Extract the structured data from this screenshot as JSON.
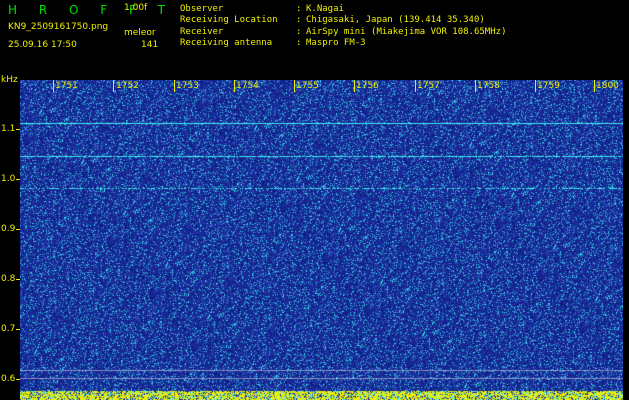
{
  "header": {
    "brand": "H R O F F T",
    "version": "1.00f",
    "filename": "KN9_2509161750.png",
    "detector": "meleor",
    "datetime": "25.09.16 17:50",
    "count": "141"
  },
  "meta": [
    {
      "label": "Observer",
      "value": "K.Nagai"
    },
    {
      "label": "Receiving Location",
      "value": "Chigasaki, Japan (139.414 35.340)"
    },
    {
      "label": "Receiver",
      "value": "AirSpy mini (Miakejima VOR 108.65MHz)"
    },
    {
      "label": "Receiving antenna",
      "value": "Maspro FM-3"
    }
  ],
  "meta_separator": ":",
  "spectrogram": {
    "y_unit": "kHz",
    "y_ticks": [
      "1.1",
      "1.0",
      "0.9",
      "0.8",
      "0.7",
      "0.6"
    ],
    "x_ticks": [
      "1751",
      "1752",
      "1753",
      "1754",
      "1755",
      "1756",
      "1757",
      "1758",
      "1759",
      "1800"
    ],
    "colors": {
      "background": "#1a2a9a",
      "noise_dark": "#0a1a7a",
      "noise_light": "#3ad0e8",
      "signal": "#40f0f0",
      "axis_text": "#f0f000",
      "bottom_band": "#f0f000"
    }
  }
}
